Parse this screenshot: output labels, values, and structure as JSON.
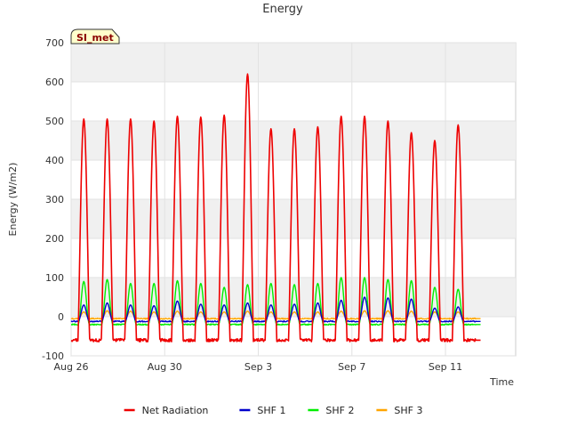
{
  "chart_data": {
    "type": "line",
    "title": "Energy",
    "xlabel": "Time",
    "ylabel": "Energy (W/m2)",
    "site_label": "SI_met",
    "xlim": [
      "2023-08-26",
      "2023-09-14"
    ],
    "ylim": [
      -100,
      700
    ],
    "yticks": [
      -100,
      0,
      100,
      200,
      300,
      400,
      500,
      600,
      700
    ],
    "xticks": [
      {
        "date": "2023-08-26",
        "label": "Aug 26"
      },
      {
        "date": "2023-08-30",
        "label": "Aug 30"
      },
      {
        "date": "2023-09-03",
        "label": "Sep 3"
      },
      {
        "date": "2023-09-07",
        "label": "Sep 7"
      },
      {
        "date": "2023-09-11",
        "label": "Sep 11"
      }
    ],
    "grid": true,
    "legend_position": "bottom-center",
    "days": [
      "2023-08-26",
      "2023-08-27",
      "2023-08-28",
      "2023-08-29",
      "2023-08-30",
      "2023-08-31",
      "2023-09-01",
      "2023-09-02",
      "2023-09-03",
      "2023-09-04",
      "2023-09-05",
      "2023-09-06",
      "2023-09-07",
      "2023-09-08",
      "2023-09-09",
      "2023-09-10",
      "2023-09-11",
      "2023-09-12"
    ],
    "series": [
      {
        "name": "Net Radiation",
        "color": "#ee0000",
        "daily_peak": [
          505,
          505,
          505,
          500,
          512,
          510,
          515,
          620,
          480,
          480,
          485,
          512,
          512,
          500,
          470,
          450,
          490,
          0
        ],
        "night_min": -60
      },
      {
        "name": "SHF 1",
        "color": "#0000cc",
        "daily_peak": [
          30,
          35,
          30,
          28,
          40,
          32,
          30,
          35,
          30,
          32,
          35,
          42,
          50,
          48,
          45,
          22,
          25,
          0
        ],
        "night_min": -12
      },
      {
        "name": "SHF 2",
        "color": "#00ee00",
        "daily_peak": [
          90,
          95,
          85,
          85,
          92,
          85,
          75,
          82,
          85,
          82,
          85,
          100,
          100,
          95,
          92,
          75,
          70,
          0
        ],
        "night_min": -20
      },
      {
        "name": "SHF 3",
        "color": "#ffa500",
        "daily_peak": [
          12,
          15,
          14,
          12,
          14,
          12,
          12,
          14,
          12,
          12,
          12,
          14,
          15,
          15,
          14,
          12,
          12,
          0
        ],
        "night_min": -5
      }
    ]
  }
}
